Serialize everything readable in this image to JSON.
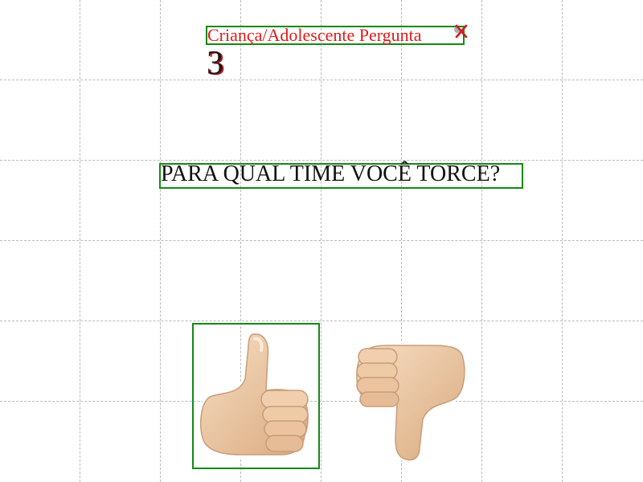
{
  "header": {
    "title": "Criança/Adolescente Pergunta",
    "question_number": "3",
    "close_icon": "close-x-icon"
  },
  "question": {
    "text": "PARA QUAL TIME VOCÊ TORCE?"
  },
  "answers": [
    {
      "name": "thumbs-up",
      "icon": "thumbs-up-icon",
      "selected": true
    },
    {
      "name": "thumbs-down",
      "icon": "thumbs-down-icon",
      "selected": false
    }
  ],
  "colors": {
    "title": "#e01b1b",
    "highlight_border": "#138a13",
    "grid": "#b9b9b9",
    "skin": "#f1cfae"
  }
}
